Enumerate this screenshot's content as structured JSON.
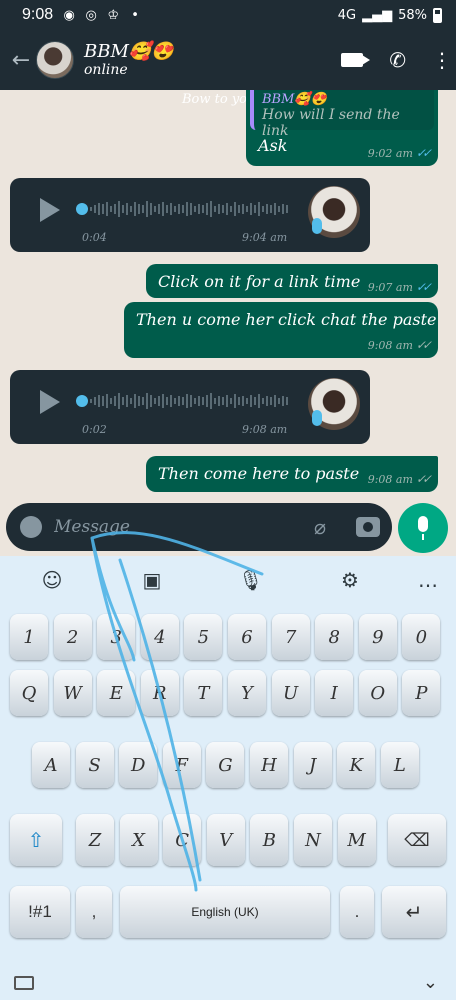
{
  "status_bar": {
    "time": "9:08",
    "network": "4G",
    "battery": "58%",
    "icons": [
      "whatsapp-icon",
      "sync-icon",
      "crown-icon",
      "dot-icon"
    ]
  },
  "header": {
    "contact_name": "BBM🥰😍",
    "status": "online",
    "icons": [
      "back-arrow-icon",
      "video-call-icon",
      "phone-icon",
      "more-vert-icon"
    ]
  },
  "messages": {
    "forward_label": "Bow to your 🤴",
    "reply": {
      "quoted_author": "BBM🥰😍",
      "quoted_text": "How will I send the link",
      "text": "Ask",
      "time": "9:02 am"
    },
    "voice_1": {
      "duration": "0:04",
      "time": "9:04 am"
    },
    "out_1": {
      "text": "Click on it for a link time",
      "time": "9:07 am"
    },
    "out_2": {
      "text": "Then u come her click chat the paste",
      "time": "9:08 am"
    },
    "voice_2": {
      "duration": "0:02",
      "time": "9:08 am"
    },
    "out_3": {
      "text": "Then come here to paste",
      "time": "9:08 am"
    }
  },
  "composer": {
    "placeholder": "Message"
  },
  "keyboard": {
    "number_row": [
      "1",
      "2",
      "3",
      "4",
      "5",
      "6",
      "7",
      "8",
      "9",
      "0"
    ],
    "row_1": [
      "Q",
      "W",
      "E",
      "R",
      "T",
      "Y",
      "U",
      "I",
      "O",
      "P"
    ],
    "row_2": [
      "A",
      "S",
      "D",
      "F",
      "G",
      "H",
      "J",
      "K",
      "L"
    ],
    "row_3": [
      "Z",
      "X",
      "C",
      "V",
      "B",
      "N",
      "M"
    ],
    "symbols_label": "!#1",
    "comma_label": ",",
    "period_label": ".",
    "space_label": "English (UK)"
  },
  "colors": {
    "header_bg": "#1f2c34",
    "outgoing_bubble": "#005c4b",
    "incoming_bubble": "#1f2c34",
    "accent_green": "#00a884",
    "read_tick_blue": "#53bdeb",
    "keyboard_bg": "#dfeef9"
  }
}
